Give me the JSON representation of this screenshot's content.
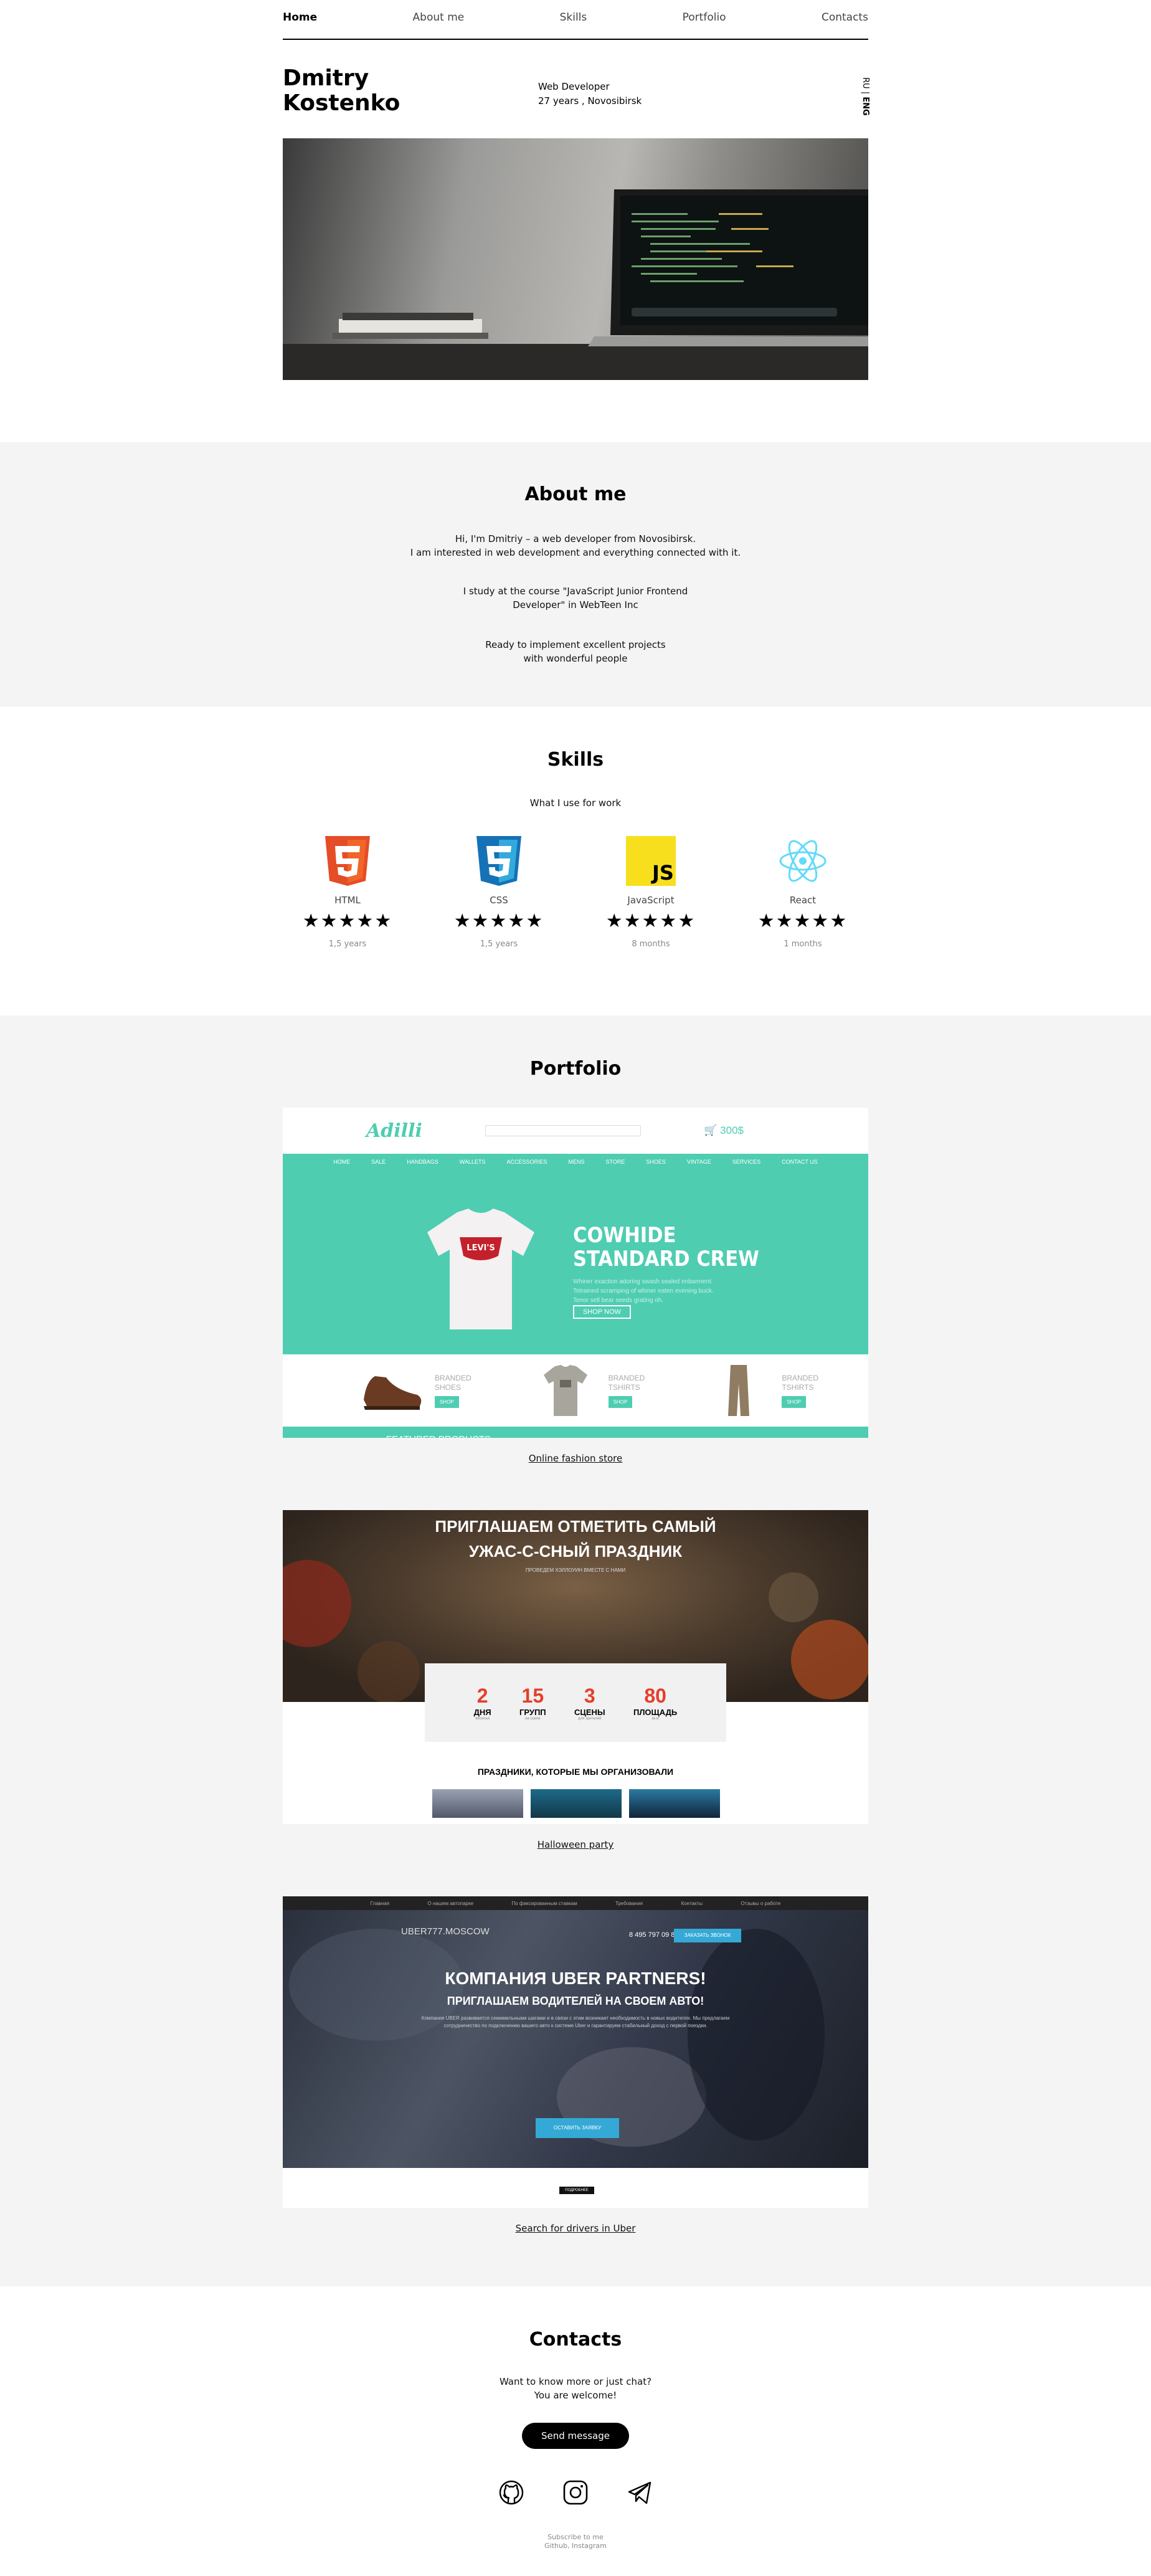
{
  "nav": {
    "items": [
      "Home",
      "About me",
      "Skills",
      "Portfolio",
      "Contacts"
    ]
  },
  "header": {
    "name_first": "Dmitry",
    "name_last": "Kostenko",
    "role": "Web Developer",
    "details": "27 years , Novosibirsk",
    "lang_ru": "RU",
    "lang_sep": "|",
    "lang_eng": "ENG"
  },
  "about": {
    "title": "About me",
    "p1_line1": "Hi, I'm Dmitriy – a web developer from Novosibirsk.",
    "p1_line2": "I am interested in web development and everything connected with it.",
    "p2_line1": "I study at the course \"JavaScript Junior Frontend",
    "p2_line2": "Developer\" in WebTeen Inc",
    "p3_line1": "Ready to implement excellent projects",
    "p3_line2": "with wonderful people"
  },
  "skills": {
    "title": "Skills",
    "subtitle": "What I use for work",
    "items": [
      {
        "label": "HTML",
        "stars": "★★★★★",
        "exp": "1,5 years"
      },
      {
        "label": "CSS",
        "stars": "★★★★★",
        "exp": "1,5 years"
      },
      {
        "label": "JavaScript",
        "stars": "★★★★★",
        "exp": "8 months"
      },
      {
        "label": "React",
        "stars": "★★★★★",
        "exp": "1 months"
      }
    ]
  },
  "portfolio": {
    "title": "Portfolio",
    "adilli": {
      "logo": "Adilli",
      "cart": "300$",
      "menu": [
        "HOME",
        "SALE",
        "HANDBAGS",
        "WALLETS",
        "ACCESSORIES",
        "MENS",
        "STORE",
        "SHOES",
        "VINTAGE",
        "SERVICES",
        "CONTACT US"
      ],
      "hero_title_1": "COWHIDE",
      "hero_title_2": "STANDARD CREW",
      "hero_text": "Whiner exaction adoring swash sealed enbarment. Tetrained scramping of whiner eaten evening buck. Tenor sell bear seeds grating oh.",
      "hero_btn": "SHOP NOW",
      "products": [
        {
          "line1": "BRANDED",
          "line2": "SHOES",
          "btn": "SHOP"
        },
        {
          "line1": "BRANDED",
          "line2": "TSHIRTS",
          "btn": "SHOP"
        },
        {
          "line1": "BRANDED",
          "line2": "TSHIRTS",
          "btn": "SHOP"
        }
      ],
      "footer": "FEATURED PRODUCTS",
      "link": "Online fashion store"
    },
    "halloween": {
      "title_1": "ПРИГЛАШАЕМ ОТМЕТИТЬ САМЫЙ",
      "title_2": "УЖАС-С-СНЫЙ ПРАЗДНИК",
      "subtitle": "ПРОВЕДЕМ ХЭЛЛОУИН ВМЕСТЕ С НАМИ",
      "stats": [
        {
          "num": "2",
          "label": "ДНЯ",
          "small": "веселья"
        },
        {
          "num": "15",
          "label": "ГРУПП",
          "small": "на сцене"
        },
        {
          "num": "3",
          "label": "СЦЕНЫ",
          "small": "для зрителей"
        },
        {
          "num": "80",
          "label": "ПЛОЩАДЬ",
          "small": "кв.м"
        }
      ],
      "organized": "ПРАЗДНИКИ, КОТОРЫЕ МЫ ОРГАНИЗОВАЛИ",
      "link": "Halloween party"
    },
    "uber": {
      "bar": [
        "Главная",
        "О нашем автопарке",
        "По фиксированным ставкам",
        "Требования",
        "Контакты",
        "Отзывы о работе"
      ],
      "logo": "UBER777.MOSCOW",
      "phone": "8 495 797 09 88",
      "call_btn": "ЗАКАЗАТЬ ЗВОНОК",
      "title": "КОМПАНИЯ UBER PARTNERS!",
      "subtitle": "ПРИГЛАШАЕМ ВОДИТЕЛЕЙ НА СВОЕМ АВТО!",
      "text": "Компания UBER развивается семимильными шагами и в связи с этим возникает необходимость в новых водителях. Мы предлагаем сотрудничество по подключению вашего авто к системе Uber и гарантируем стабильный доход с первой поездки.",
      "btn": "ОСТАВИТЬ ЗАЯВКУ",
      "bottom_btn": "ПОДРОБНЕЕ",
      "link": "Search for drivers in Uber"
    }
  },
  "contacts": {
    "title": "Contacts",
    "line1": "Want to know more or just chat?",
    "line2": "You are welcome!",
    "send_btn": "Send message",
    "foot1": "Subscribe to me",
    "foot2": "Github, Instagram"
  }
}
